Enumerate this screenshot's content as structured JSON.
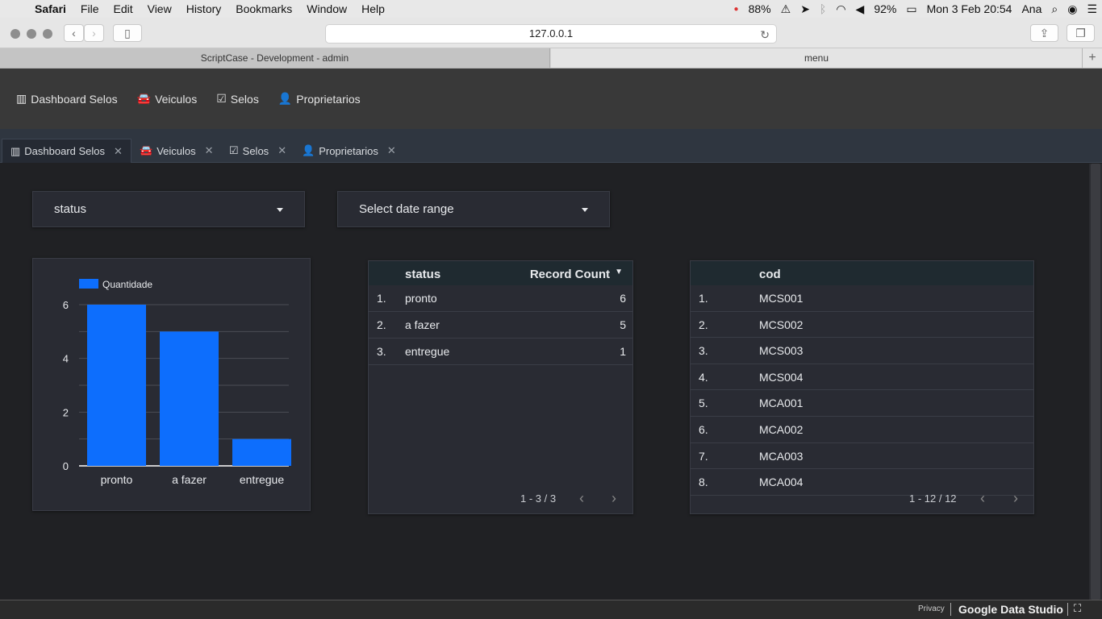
{
  "mac_menu": {
    "app": "Safari",
    "items": [
      "File",
      "Edit",
      "View",
      "History",
      "Bookmarks",
      "Window",
      "Help"
    ],
    "status": {
      "battery_pct_1": "88%",
      "battery_pct_2": "92%",
      "datetime": "Mon 3 Feb  20:54",
      "user": "Ana"
    }
  },
  "browser": {
    "url": "127.0.0.1",
    "tabs": [
      "ScriptCase - Development - admin",
      "menu"
    ]
  },
  "app_nav": [
    "Dashboard Selos",
    "Veiculos",
    "Selos",
    "Proprietarios"
  ],
  "app_tabs": [
    "Dashboard Selos",
    "Veiculos",
    "Selos",
    "Proprietarios"
  ],
  "filters": {
    "status_label": "status",
    "date_label": "Select date range"
  },
  "chart_data": {
    "type": "bar",
    "categories": [
      "pronto",
      "a fazer",
      "entregue"
    ],
    "series": [
      {
        "name": "Quantidade",
        "values": [
          6,
          5,
          1
        ]
      }
    ],
    "yticks": [
      0,
      2,
      4,
      6
    ],
    "ylim": [
      0,
      6
    ],
    "color": "#0d6efd",
    "legend_position": "top-left"
  },
  "status_table": {
    "headers": [
      "status",
      "Record Count"
    ],
    "rows": [
      {
        "n": "1.",
        "status": "pronto",
        "count": "6"
      },
      {
        "n": "2.",
        "status": "a fazer",
        "count": "5"
      },
      {
        "n": "3.",
        "status": "entregue",
        "count": "1"
      }
    ],
    "pagination": "1 - 3 / 3"
  },
  "cod_table": {
    "header": "cod",
    "rows": [
      {
        "n": "1.",
        "cod": "MCS001"
      },
      {
        "n": "2.",
        "cod": "MCS002"
      },
      {
        "n": "3.",
        "cod": "MCS003"
      },
      {
        "n": "4.",
        "cod": "MCS004"
      },
      {
        "n": "5.",
        "cod": "MCA001"
      },
      {
        "n": "6.",
        "cod": "MCA002"
      },
      {
        "n": "7.",
        "cod": "MCA003"
      },
      {
        "n": "8.",
        "cod": "MCA004"
      }
    ],
    "pagination": "1 - 12 / 12"
  },
  "footer": {
    "privacy": "Privacy",
    "brand": "Google Data Studio"
  }
}
